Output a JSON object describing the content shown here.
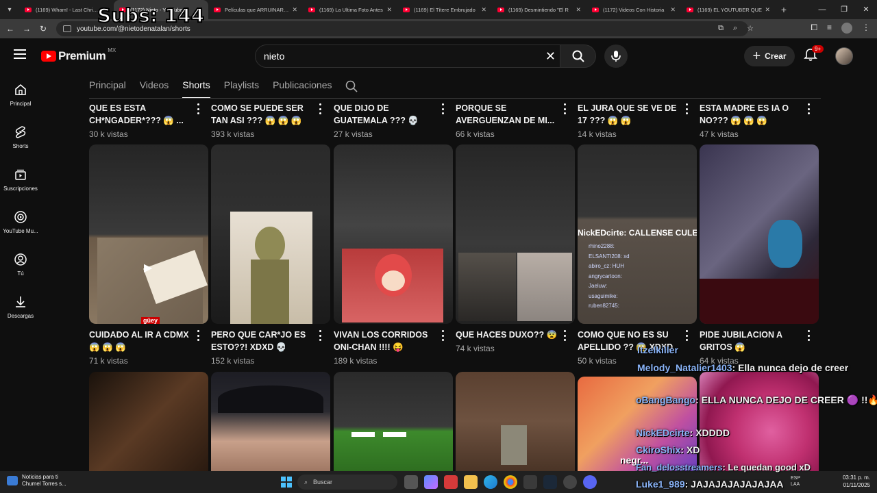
{
  "overlay": {
    "subs": "Subs: 144"
  },
  "browser": {
    "tabs": [
      {
        "title": "(1169) Wham! - Last Christmas",
        "active": false
      },
      {
        "title": "(1172) Nieto - YouTube",
        "active": true
      },
      {
        "title": "Películas que ARRUINARON",
        "active": false
      },
      {
        "title": "(1169) La Ultima Foto Antes",
        "active": false
      },
      {
        "title": "(1169) El Títere Embrujado",
        "active": false
      },
      {
        "title": "(1169) Desmintiendo \"El R",
        "active": false
      },
      {
        "title": "(1172) Videos Con Historia",
        "active": false
      },
      {
        "title": "(1169) EL YOUTUBER QUE",
        "active": false
      }
    ],
    "url": "youtube.com/@nietodenatalan/shorts"
  },
  "header": {
    "logo": "Premium",
    "region": "MX",
    "search_value": "nieto",
    "create_label": "Crear",
    "notif_badge": "9+"
  },
  "sidebar": [
    {
      "label": "Principal",
      "icon": "home-icon"
    },
    {
      "label": "Shorts",
      "icon": "shorts-icon"
    },
    {
      "label": "Suscripciones",
      "icon": "subscriptions-icon"
    },
    {
      "label": "YouTube Mu...",
      "icon": "music-icon"
    },
    {
      "label": "Tú",
      "icon": "you-icon"
    },
    {
      "label": "Descargas",
      "icon": "download-icon"
    }
  ],
  "channel_tabs": [
    "Principal",
    "Videos",
    "Shorts",
    "Playlists",
    "Publicaciones"
  ],
  "row1": [
    {
      "title": "QUE ES ESTA CH*NGADER*??? 😱 ...",
      "views": "30 k vistas"
    },
    {
      "title": "COMO SE PUEDE SER TAN ASI ??? 😱 😱 😱",
      "views": "393 k vistas"
    },
    {
      "title": "QUE DIJO DE GUATEMALA ??? 💀",
      "views": "27 k vistas"
    },
    {
      "title": "PORQUE SE AVERGUENZAN DE MI...",
      "views": "66 k vistas"
    },
    {
      "title": "EL JURA QUE SE VE DE 17 ??? 😱 😱",
      "views": "14 k vistas"
    },
    {
      "title": "ESTA MADRE ES IA O NO??? 😱 😱 😱",
      "views": "47 k vistas"
    }
  ],
  "row2": [
    {
      "title": "CUIDADO AL IR A CDMX 😱 😱 😱",
      "views": "71 k vistas"
    },
    {
      "title": "PERO QUE CAR*JO ES ESTO??! XDXD 💀",
      "views": "152 k vistas"
    },
    {
      "title": "VIVAN LOS CORRIDOS ONI-CHAN !!!! 😝",
      "views": "189 k vistas"
    },
    {
      "title": "QUE HACES DUXO?? 😨",
      "views": "74 k vistas"
    },
    {
      "title": "COMO QUE NO ES SU APELLIDO ?? 😱 XDXD",
      "views": "50 k vistas"
    },
    {
      "title": "PIDE JUBILACION A GRITOS 😱",
      "views": "64 k vistas"
    }
  ],
  "thumb_overlay": {
    "chat_top": "NickEDcirte: CALLENSE CULE",
    "chat_users": [
      "rhino2288:",
      "ELSANTI208: xd",
      "abiro_cz: HUH",
      "angrycartoon:",
      "Jaeluw:",
      "usaguimike:",
      "ruben82745:"
    ],
    "sticker": "güey",
    "corner_caption": "negr..."
  },
  "chat_overlay": [
    {
      "user": "Itzelkiller",
      "msg": ""
    },
    {
      "user": "Melody_Natalier1403",
      "msg": ": Ella nunca dejo de creer"
    },
    {
      "user": "oBangBango",
      "msg": ": ELLA NUNCA DEJO DE CREER 🟣 !!🔥"
    },
    {
      "user": "NickEDcirte",
      "msg": ": XDDDD"
    },
    {
      "user": "CkiroShix",
      "msg": ": XD"
    },
    {
      "user": "Fan_delosstreamers",
      "msg": ": Le quedan good xD"
    },
    {
      "user": "Luke1_989",
      "msg": ": JAJAJAJAJAJAJAA"
    }
  ],
  "taskbar": {
    "news_title": "Noticias para ti",
    "news_sub": "Chumel Torres s...",
    "search": "Buscar",
    "lang": "ESP",
    "lang2": "LAA",
    "time": "03:31 p. m.",
    "date": "01/11/2025"
  }
}
